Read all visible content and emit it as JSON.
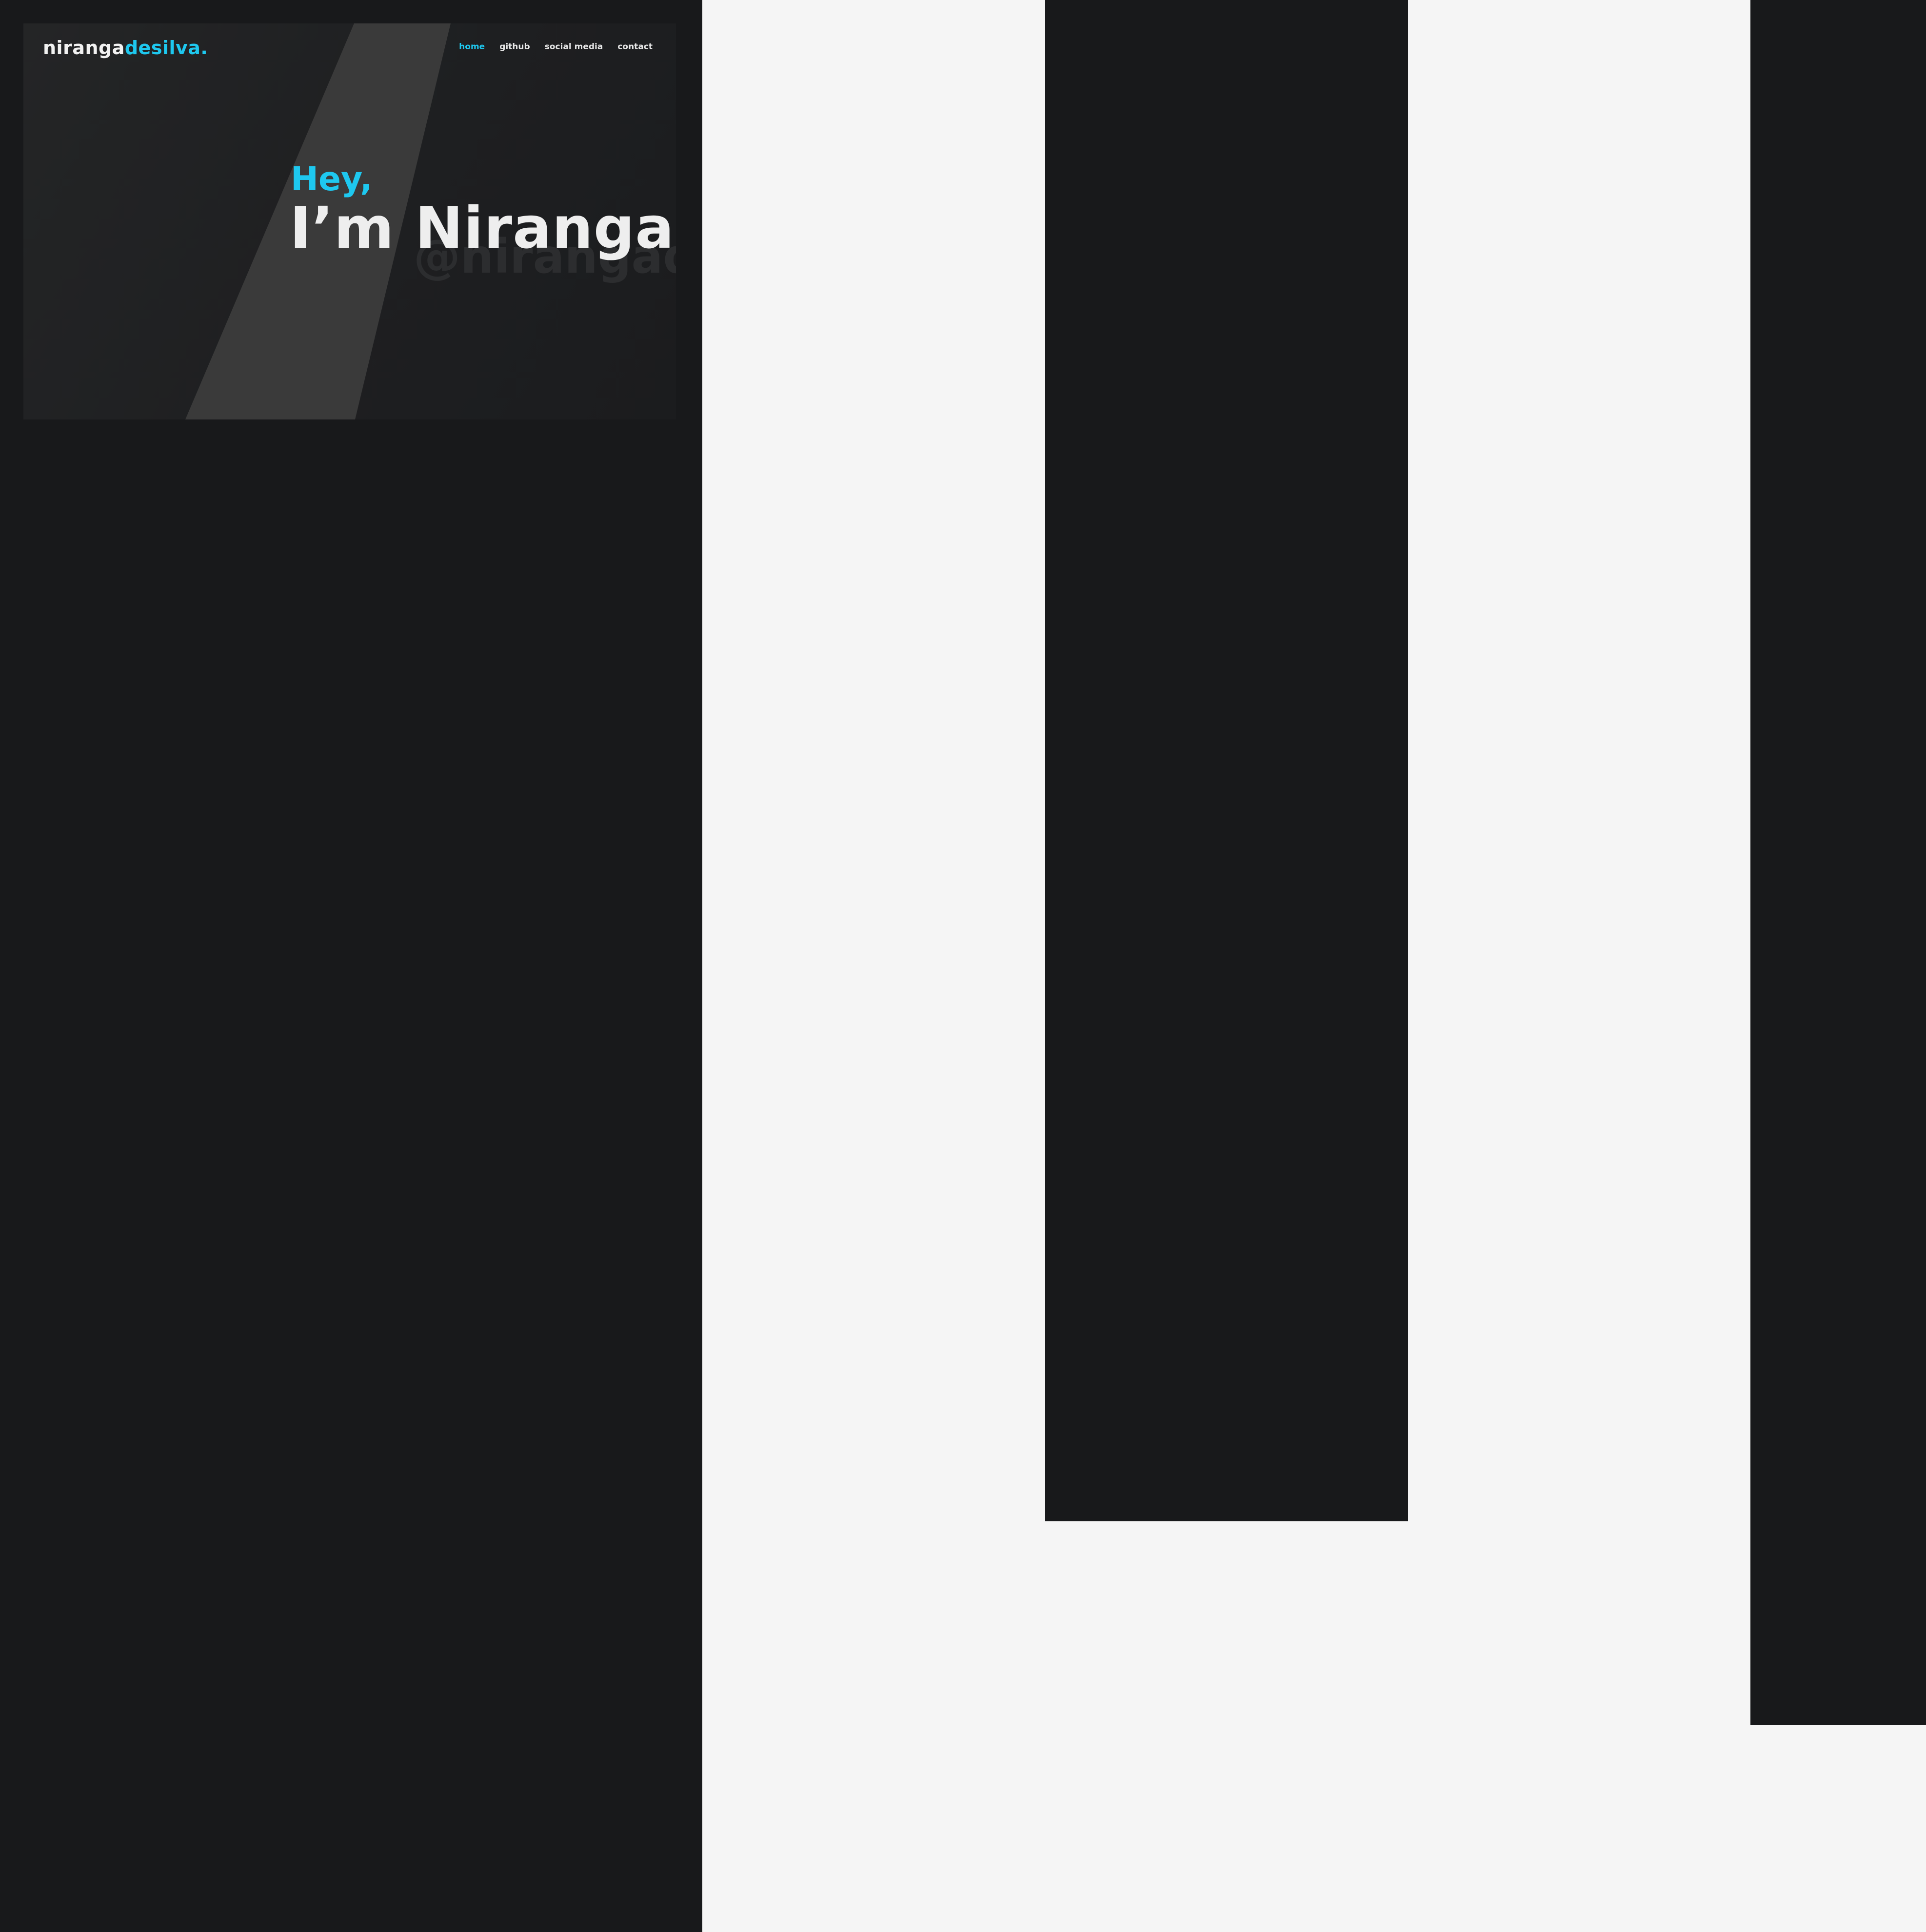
{
  "logo": {
    "first": "niranga",
    "second": "desilva."
  },
  "nav": {
    "items": [
      {
        "label": "home",
        "active": true
      },
      {
        "label": "github",
        "active": false
      },
      {
        "label": "social media",
        "active": false
      },
      {
        "label": "contact",
        "active": false
      }
    ]
  },
  "hero": {
    "greeting": "Hey,",
    "headline": "I’m Niranga",
    "watermark": "@nirangad"
  },
  "colors": {
    "accent": "#1ec8ef",
    "dark": "#18191b",
    "light": "#f5f5f5"
  }
}
